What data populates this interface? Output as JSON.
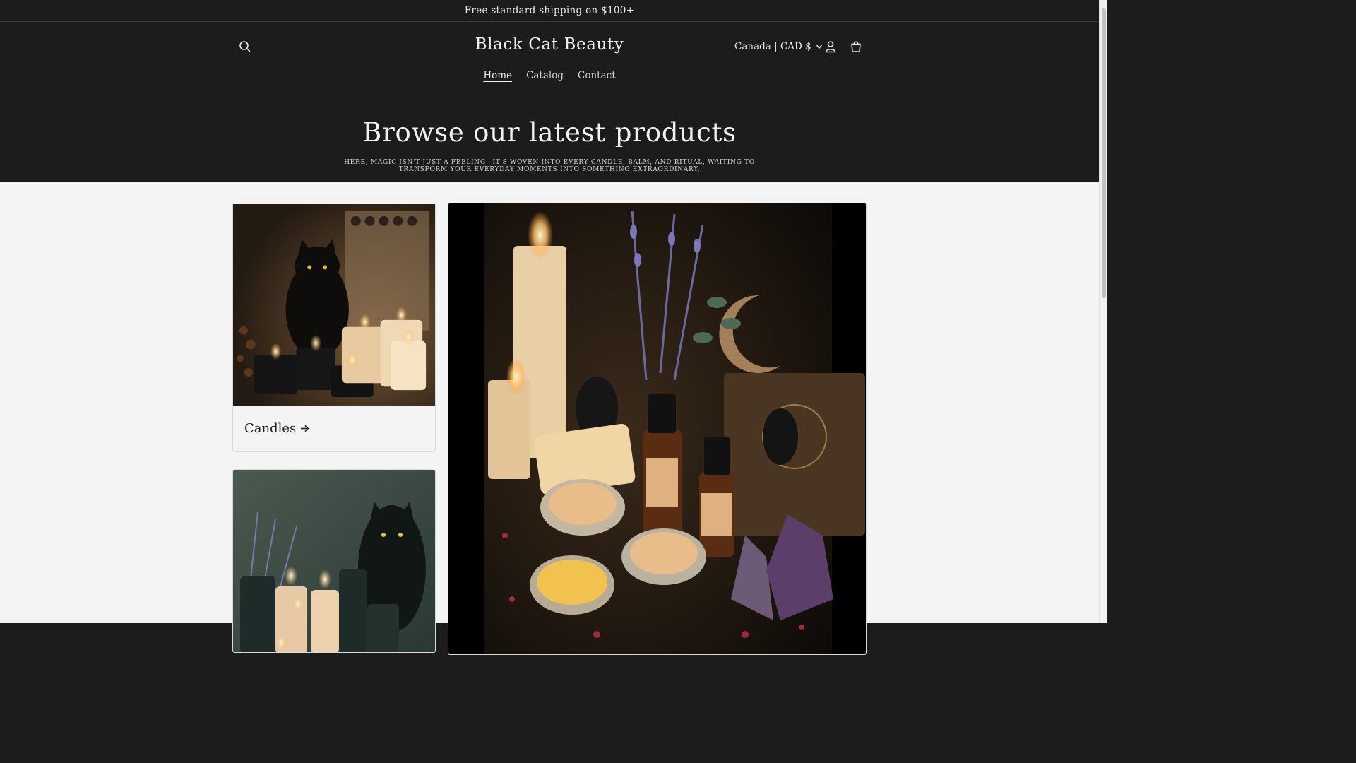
{
  "announcement": {
    "text": "Free standard shipping on $100+"
  },
  "header": {
    "logo": "Black Cat Beauty",
    "currency": "Canada | CAD $",
    "icons": {
      "search": "search-icon",
      "account": "account-icon",
      "cart": "cart-icon",
      "chevron": "chevron-down-icon"
    }
  },
  "nav": {
    "items": [
      {
        "label": "Home"
      },
      {
        "label": "Catalog"
      },
      {
        "label": "Contact"
      }
    ]
  },
  "hero": {
    "title": "Browse our latest products",
    "subtitle": "HERE, MAGIC ISN'T JUST A FEELING—IT'S WOVEN INTO EVERY CANDLE, BALM, AND RITUAL, WAITING TO TRANSFORM YOUR EVERYDAY MOMENTS INTO SOMETHING EXTRAORDINARY."
  },
  "collections": [
    {
      "title": "Candles",
      "image": "candles-with-black-cat-and-moon"
    },
    {
      "title": "",
      "image": "balms-oils-soap-with-black-cats"
    },
    {
      "title": "",
      "image": "teal-toned-cat-with-candles-and-lavender"
    }
  ],
  "colors": {
    "dark_bg": "#1c1c1c",
    "light_bg": "#f4f4f4",
    "text_light": "#ececec",
    "text_dark": "#222222"
  }
}
